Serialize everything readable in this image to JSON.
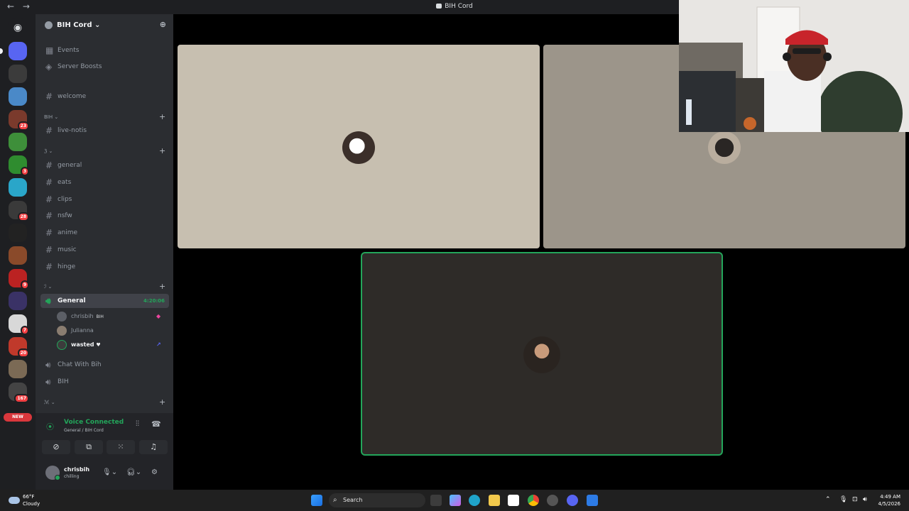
{
  "window": {
    "title": "BIH Cord",
    "back": "←",
    "forward": "→"
  },
  "rail": {
    "home_icon": "discord-icon",
    "badges": [
      "23",
      "3",
      "28",
      "9",
      "7",
      "20",
      "167"
    ],
    "new_label": "NEW"
  },
  "server": {
    "name": "BIH Cord ⌄",
    "invite_icon": "add-user-icon"
  },
  "sidebar": {
    "top_items": [
      {
        "label": "Events",
        "icon": "calendar-icon"
      },
      {
        "label": "Server Boosts",
        "icon": "boost-icon"
      }
    ],
    "welcome": "welcome",
    "categories": [
      {
        "label": "BIH ⌄"
      },
      {
        "label": "ℨ ⌄"
      },
      {
        "label": "ℐ ⌄"
      },
      {
        "label": "ℳ ⌄"
      }
    ],
    "text_channels": [
      "live-notis",
      "general",
      "eats",
      "clips",
      "nsfw",
      "anime",
      "music",
      "hinge"
    ],
    "voice_active": {
      "label": "General",
      "timer": "4:20:06"
    },
    "voice_users": [
      {
        "name": "chrisbih",
        "tag": "BIH"
      },
      {
        "name": "Julianna",
        "tag": ""
      },
      {
        "name": "wasted",
        "tag": ""
      }
    ],
    "voice_channels": [
      "Chat With Bih",
      "BIH"
    ]
  },
  "voice_panel": {
    "status": "Voice Connected",
    "location": "General / BIH Cord"
  },
  "profile": {
    "name": "chrisbih",
    "status": "chilling"
  },
  "taskbar": {
    "temp": "66°F",
    "condition": "Cloudy",
    "search": "Search",
    "time": "4:49 AM",
    "date": "4/5/2026"
  },
  "colors": {
    "accent_green": "#23a55a",
    "badge_red": "#f23f42",
    "sidebar": "#2b2d31",
    "rail": "#1e1f22"
  }
}
